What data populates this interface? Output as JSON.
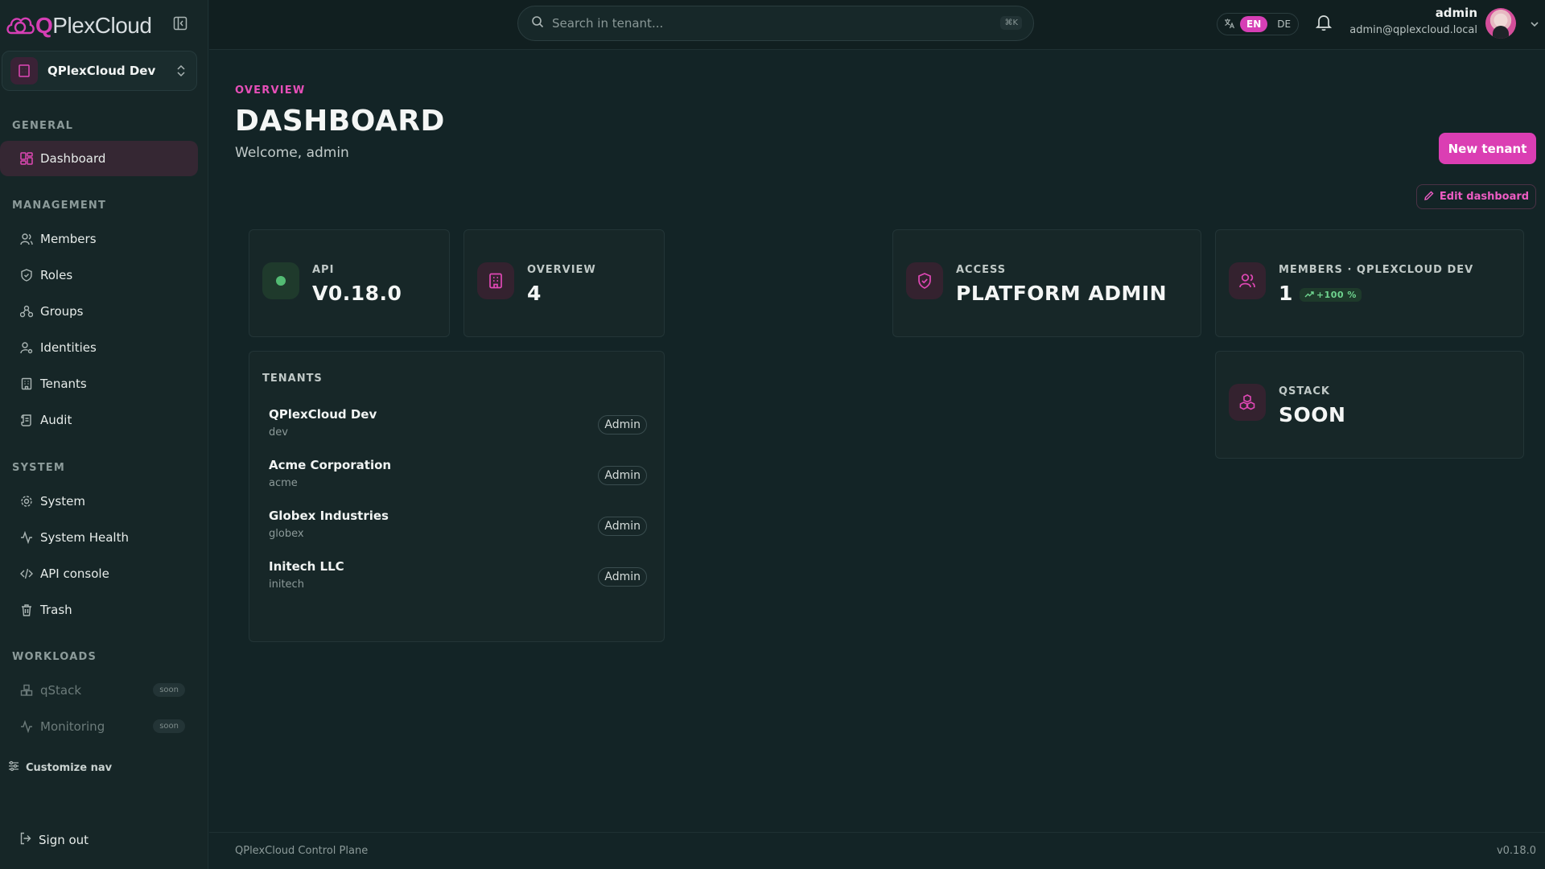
{
  "brand": {
    "prefix": "Q",
    "name": "PlexCloud"
  },
  "tenant_switcher": {
    "name": "QPlexCloud Dev"
  },
  "sidebar": {
    "sections": {
      "general": "GENERAL",
      "management": "MANAGEMENT",
      "system": "SYSTEM",
      "workloads": "WORKLOADS"
    },
    "items": {
      "dashboard": "Dashboard",
      "members": "Members",
      "roles": "Roles",
      "groups": "Groups",
      "identities": "Identities",
      "tenants": "Tenants",
      "audit": "Audit",
      "system": "System",
      "system_health": "System Health",
      "api_console": "API console",
      "trash": "Trash",
      "qstack": "qStack",
      "monitoring": "Monitoring"
    },
    "soon_label": "soon",
    "customize": "Customize nav",
    "signout": "Sign out"
  },
  "topbar": {
    "search_placeholder": "Search in tenant...",
    "shortcut": "⌘K",
    "lang_en": "EN",
    "lang_de": "DE",
    "user_name": "admin",
    "user_email": "admin@qplexcloud.local"
  },
  "header": {
    "eyebrow": "OVERVIEW",
    "title": "DASHBOARD",
    "welcome": "Welcome, admin",
    "new_tenant": "New tenant",
    "edit_dashboard": "Edit dashboard"
  },
  "stats": {
    "api": {
      "label": "API",
      "value": "V0.18.0"
    },
    "overview": {
      "label": "OVERVIEW",
      "value": "4"
    },
    "access": {
      "label": "ACCESS",
      "value": "PLATFORM ADMIN"
    },
    "members": {
      "label": "MEMBERS · QPLEXCLOUD DEV",
      "value": "1",
      "trend": "+100 %"
    },
    "qstack": {
      "label": "QSTACK",
      "value": "SOON"
    }
  },
  "tenants_card": {
    "title": "TENANTS",
    "rows": [
      {
        "name": "QPlexCloud Dev",
        "slug": "dev",
        "role": "Admin"
      },
      {
        "name": "Acme Corporation",
        "slug": "acme",
        "role": "Admin"
      },
      {
        "name": "Globex Industries",
        "slug": "globex",
        "role": "Admin"
      },
      {
        "name": "Initech LLC",
        "slug": "initech",
        "role": "Admin"
      }
    ]
  },
  "footer": {
    "left": "QPlexCloud Control Plane",
    "right": "v0.18.0"
  },
  "colors": {
    "accent": "#db3eb3",
    "success": "#6fd48f",
    "background": "#132426"
  }
}
